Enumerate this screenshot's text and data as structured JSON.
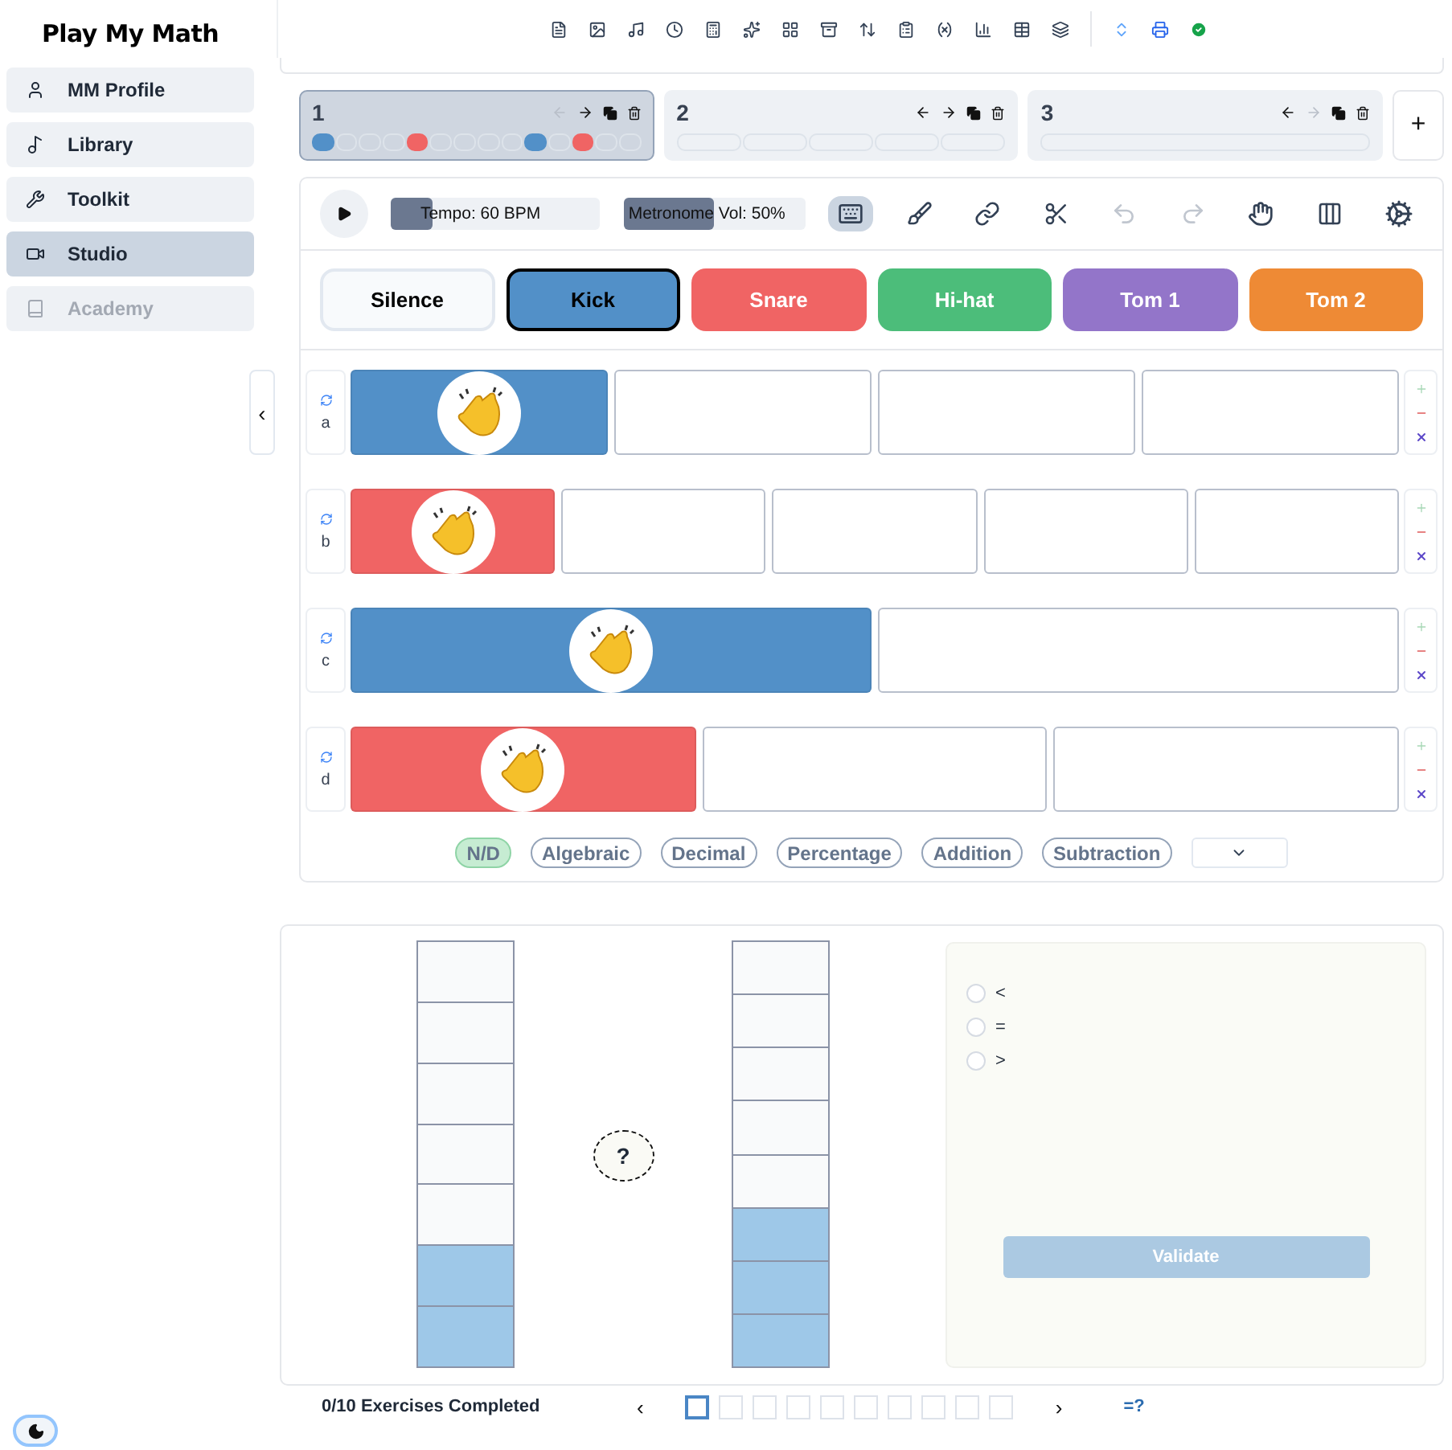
{
  "sidebar": {
    "logo": "Play My Math",
    "items": [
      {
        "label": "MM Profile",
        "selected": false,
        "disabled": false
      },
      {
        "label": "Library",
        "selected": false,
        "disabled": false
      },
      {
        "label": "Toolkit",
        "selected": false,
        "disabled": false
      },
      {
        "label": "Studio",
        "selected": true,
        "disabled": false
      },
      {
        "label": "Academy",
        "selected": false,
        "disabled": true
      }
    ],
    "collapse": "‹"
  },
  "patterns": [
    {
      "label": "1",
      "selected": true,
      "prev_disabled": true,
      "next_disabled": false,
      "steps": [
        {
          "kind": "kick"
        },
        {
          "kind": "empty"
        },
        {
          "kind": "empty"
        },
        {
          "kind": "empty"
        },
        {
          "kind": "snare"
        },
        {
          "kind": "empty"
        },
        {
          "kind": "empty"
        },
        {
          "kind": "empty"
        },
        {
          "kind": "empty"
        },
        {
          "kind": "kick"
        },
        {
          "kind": "empty"
        },
        {
          "kind": "snare"
        },
        {
          "kind": "empty"
        },
        {
          "kind": "empty"
        }
      ]
    },
    {
      "label": "2",
      "selected": false,
      "prev_disabled": false,
      "next_disabled": false,
      "steps": [
        {
          "kind": "empty"
        },
        {
          "kind": "empty"
        },
        {
          "kind": "empty"
        },
        {
          "kind": "empty"
        },
        {
          "kind": "empty"
        }
      ]
    },
    {
      "label": "3",
      "selected": false,
      "prev_disabled": false,
      "next_disabled": true,
      "steps": [
        {
          "kind": "empty"
        }
      ]
    }
  ],
  "add_pattern": "+",
  "transport": {
    "tempo": {
      "label": "Tempo: 60 BPM",
      "level": 0.2
    },
    "metronome": {
      "label": "Metronome Vol: 50%",
      "level": 0.5
    },
    "keyboard_on": true,
    "undo_disabled": true,
    "redo_disabled": true
  },
  "instruments": [
    {
      "label": "Silence",
      "kind": "silence",
      "selected": false
    },
    {
      "label": "Kick",
      "kind": "kick",
      "selected": true
    },
    {
      "label": "Snare",
      "kind": "snare",
      "selected": false
    },
    {
      "label": "Hi-hat",
      "kind": "hihat",
      "selected": false
    },
    {
      "label": "Tom 1",
      "kind": "tom1",
      "selected": false
    },
    {
      "label": "Tom 2",
      "kind": "tom2",
      "selected": false
    }
  ],
  "rows": [
    {
      "label": "a",
      "cells": [
        {
          "kind": "kick"
        },
        {
          "kind": "empty"
        },
        {
          "kind": "empty"
        },
        {
          "kind": "empty"
        }
      ]
    },
    {
      "label": "b",
      "cells": [
        {
          "kind": "snare"
        },
        {
          "kind": "empty"
        },
        {
          "kind": "empty"
        },
        {
          "kind": "empty"
        },
        {
          "kind": "empty"
        }
      ]
    },
    {
      "label": "c",
      "cells": [
        {
          "kind": "kick"
        },
        {
          "kind": "empty"
        }
      ]
    },
    {
      "label": "d",
      "cells": [
        {
          "kind": "snare"
        },
        {
          "kind": "empty"
        },
        {
          "kind": "empty"
        }
      ]
    }
  ],
  "tags": [
    {
      "label": "N/D",
      "selected": true
    },
    {
      "label": "Algebraic",
      "selected": false
    },
    {
      "label": "Decimal",
      "selected": false
    },
    {
      "label": "Percentage",
      "selected": false
    },
    {
      "label": "Addition",
      "selected": false
    },
    {
      "label": "Subtraction",
      "selected": false
    }
  ],
  "exercise": {
    "bars": [
      {
        "cells": [
          {
            "filled": false
          },
          {
            "filled": false
          },
          {
            "filled": false
          },
          {
            "filled": false
          },
          {
            "filled": false
          },
          {
            "filled": true
          },
          {
            "filled": true
          }
        ]
      },
      {
        "cells": [
          {
            "filled": false
          },
          {
            "filled": false
          },
          {
            "filled": false
          },
          {
            "filled": false
          },
          {
            "filled": false
          },
          {
            "filled": true
          },
          {
            "filled": true
          },
          {
            "filled": true
          }
        ]
      }
    ],
    "compare": "?",
    "options": [
      {
        "label": "<",
        "selected": false
      },
      {
        "label": "=",
        "selected": false
      },
      {
        "label": ">",
        "selected": false
      }
    ],
    "validate": {
      "label": "Validate",
      "disabled": true
    }
  },
  "footer": {
    "progress": "0/10 Exercises Completed",
    "prev": "‹",
    "next": "›",
    "hint": "=?",
    "steps": [
      {
        "selected": true
      },
      {
        "selected": false
      },
      {
        "selected": false
      },
      {
        "selected": false
      },
      {
        "selected": false
      },
      {
        "selected": false
      },
      {
        "selected": false
      },
      {
        "selected": false
      },
      {
        "selected": false
      },
      {
        "selected": false
      }
    ]
  }
}
